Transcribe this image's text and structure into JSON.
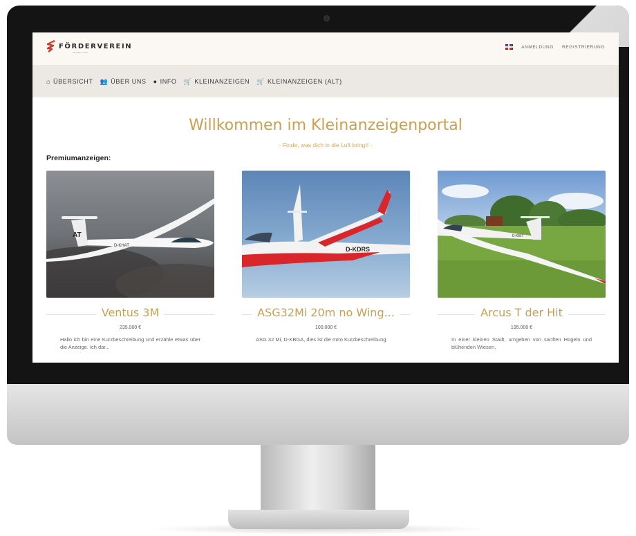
{
  "header": {
    "logo_text": "FÖRDERVEREIN",
    "logo_subtext": "SEGELFLUG",
    "language_flag": "uk-flag-icon",
    "login_label": "ANMELDUNG",
    "register_label": "REGISTRIERUNG"
  },
  "nav": {
    "items": [
      {
        "icon": "home-icon",
        "label": "ÜBERSICHT"
      },
      {
        "icon": "users-icon",
        "label": "ÜBER UNS"
      },
      {
        "icon": "info-icon",
        "label": "INFO"
      },
      {
        "icon": "cart-icon",
        "label": "KLEINANZEIGEN"
      },
      {
        "icon": "cart-icon",
        "label": "KLEINANZEIGEN (ALT)"
      }
    ]
  },
  "main": {
    "title": "Willkommen im Kleinanzeigenportal",
    "subtitle": "- Finde, was dich in die Luft bringt! -",
    "section_label": "Premiumanzeigen:",
    "cards": [
      {
        "title": "Ventus 3M",
        "price": "235.000 €",
        "description": "Hallo ich bin eine Kurzbeschreibung und erzähle etwas über die Anzeige. Ich dar...",
        "registration": "D-KHAT",
        "tail_letters": "AT"
      },
      {
        "title": "ASG32Mi 20m no Wing...",
        "price": "100.000 €",
        "description": "ASG 32 Mi, D-KBGA, dies ist die Intro Kurzbeschreibung",
        "registration": "D-KDRS"
      },
      {
        "title": "Arcus T der Hit",
        "price": "195.000 €",
        "description": "In einer kleinen Stadt, umgeben von sanften Hügeln und blühenden Wiesen,",
        "registration": "D-KBIT"
      }
    ]
  },
  "colors": {
    "accent_gold": "#c9a04f",
    "header_bg": "#fbf8f4",
    "nav_bg": "#ece8e3",
    "logo_red": "#c8372d"
  }
}
